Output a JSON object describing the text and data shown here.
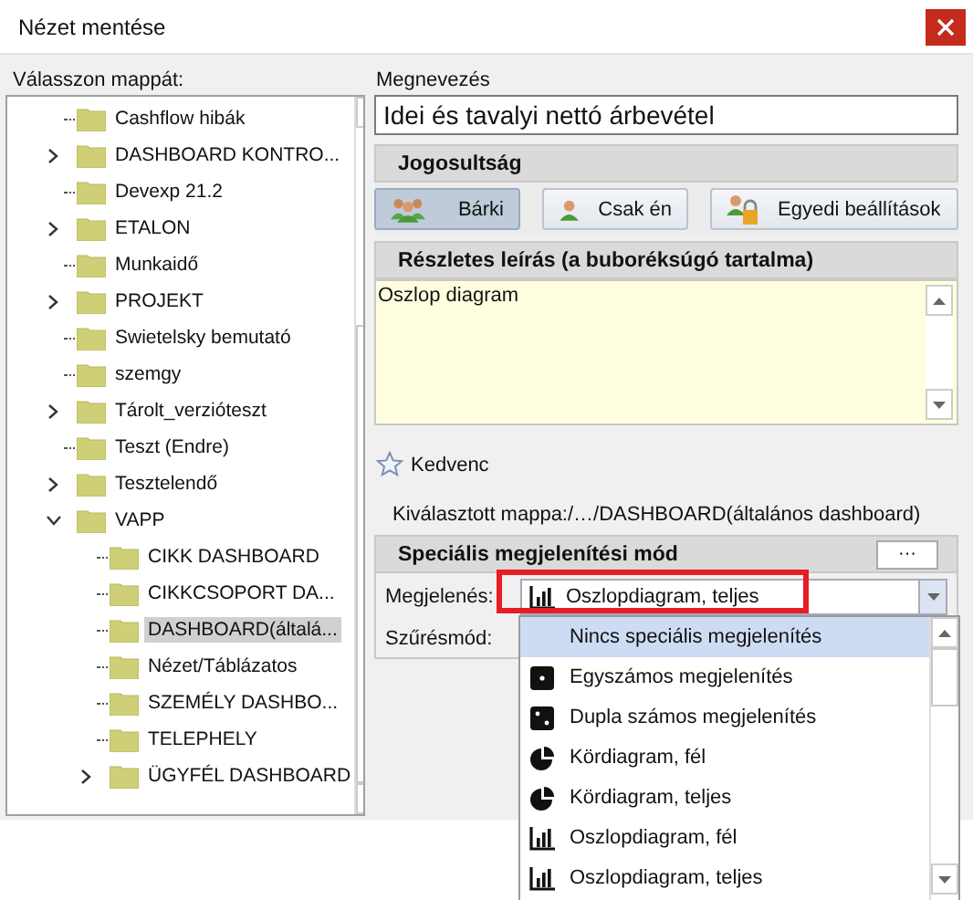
{
  "window": {
    "title": "Nézet mentése"
  },
  "folder_panel": {
    "label": "Válasszon mappát:",
    "tree": [
      {
        "name": "Cashflow hibák",
        "kind": "leaf",
        "selected": false
      },
      {
        "name": "DASHBOARD KONTRO...",
        "kind": "branch",
        "expanded": false,
        "selected": false
      },
      {
        "name": "Devexp 21.2",
        "kind": "leaf",
        "selected": false
      },
      {
        "name": "ETALON",
        "kind": "branch",
        "expanded": false,
        "selected": false
      },
      {
        "name": "Munkaidő",
        "kind": "leaf",
        "selected": false
      },
      {
        "name": "PROJEKT",
        "kind": "branch",
        "expanded": false,
        "selected": false
      },
      {
        "name": "Swietelsky bemutató",
        "kind": "leaf",
        "selected": false
      },
      {
        "name": "szemgy",
        "kind": "leaf",
        "selected": false
      },
      {
        "name": "Tárolt_verzióteszt",
        "kind": "branch",
        "expanded": false,
        "selected": false
      },
      {
        "name": "Teszt (Endre)",
        "kind": "leaf",
        "selected": false
      },
      {
        "name": "Tesztelendő",
        "kind": "branch",
        "expanded": false,
        "selected": false
      },
      {
        "name": "VAPP",
        "kind": "branch",
        "expanded": true,
        "selected": false,
        "children": [
          {
            "name": "CIKK DASHBOARD",
            "kind": "leaf",
            "selected": false
          },
          {
            "name": "CIKKCSOPORT DA...",
            "kind": "leaf",
            "selected": false
          },
          {
            "name": "DASHBOARD(általá...",
            "kind": "leaf",
            "selected": true
          },
          {
            "name": "Nézet/Táblázatos",
            "kind": "leaf",
            "selected": false
          },
          {
            "name": "SZEMÉLY DASHBO...",
            "kind": "leaf",
            "selected": false
          },
          {
            "name": "TELEPHELY",
            "kind": "leaf",
            "selected": false
          },
          {
            "name": "ÜGYFÉL DASHBOARD",
            "kind": "branch",
            "expanded": false,
            "selected": false
          }
        ]
      }
    ]
  },
  "name_field": {
    "label": "Megnevezés",
    "value": "Idei és tavalyi nettó árbevétel"
  },
  "permissions": {
    "title": "Jogosultság",
    "buttons": [
      {
        "label": "Bárki",
        "kind": "everyone",
        "selected": true
      },
      {
        "label": "Csak én",
        "kind": "me",
        "selected": false
      },
      {
        "label": "Egyedi beállítások",
        "kind": "custom",
        "selected": false
      }
    ]
  },
  "description": {
    "title": "Részletes leírás (a buboréksúgó tartalma)",
    "value": "Oszlop diagram"
  },
  "favorite": {
    "label": "Kedvenc",
    "checked": false
  },
  "selected_folder": "Kiválasztott mappa:/…/DASHBOARD(általános dashboard)",
  "special_mode": {
    "title": "Speciális megjelenítési mód",
    "more_button": "···",
    "display": {
      "label": "Megjelenés:",
      "value": "Oszlopdiagram, teljes",
      "kind": "bar",
      "highlighted": true
    },
    "filter": {
      "label": "Szűrésmód:"
    },
    "options": [
      {
        "label": "Nincs speciális megjelenítés",
        "kind": "none",
        "selected": true
      },
      {
        "label": "Egyszámos megjelenítés",
        "kind": "single",
        "selected": false
      },
      {
        "label": "Dupla számos megjelenítés",
        "kind": "double",
        "selected": false
      },
      {
        "label": "Kördiagram, fél",
        "kind": "pie",
        "selected": false
      },
      {
        "label": "Kördiagram, teljes",
        "kind": "pie",
        "selected": false
      },
      {
        "label": "Oszlopdiagram, fél",
        "kind": "bar",
        "selected": false
      },
      {
        "label": "Oszlopdiagram, teljes",
        "kind": "bar",
        "selected": false
      }
    ]
  }
}
